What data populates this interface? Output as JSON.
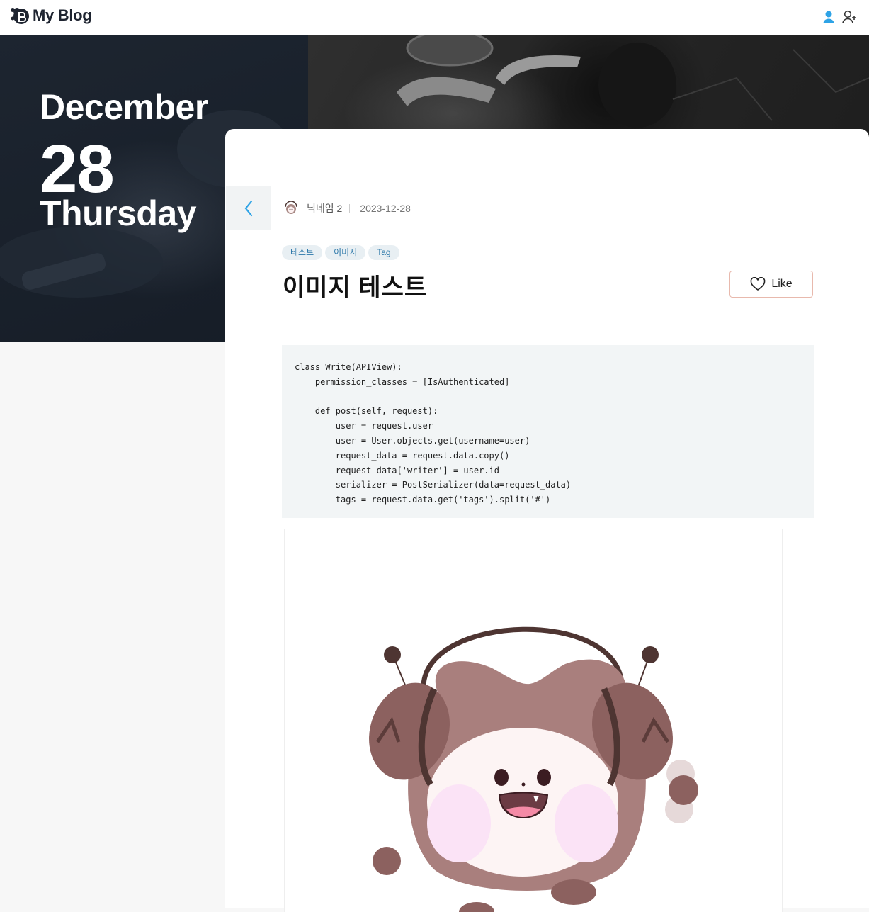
{
  "header": {
    "title": "My Blog",
    "icons": {
      "logo": "blog-logo-icon",
      "user": "user-icon",
      "add_user": "add-user-icon"
    },
    "accent": "#2ea3e6"
  },
  "hero": {
    "month": "December",
    "day": "28",
    "weekday": "Thursday"
  },
  "post": {
    "back_icon": "chevron-left-icon",
    "author": "닉네임 2",
    "date": "2023-12-28",
    "tags": [
      "테스트",
      "이미지",
      "Tag"
    ],
    "title": "이미지 테스트",
    "like_label": "Like",
    "code": "class Write(APIView):\n    permission_classes = [IsAuthenticated]\n\n    def post(self, request):\n        user = request.user\n        user = User.objects.get(username=user)\n        request_data = request.data.copy()\n        request_data['writer'] = user.id\n        serializer = PostSerializer(data=request_data)\n        tags = request.data.get('tags').split('#')",
    "image": "character-illustration"
  },
  "colors": {
    "tag_bg": "#e8eff3",
    "tag_text": "#2b77a9",
    "like_border": "#e8b9ad"
  }
}
